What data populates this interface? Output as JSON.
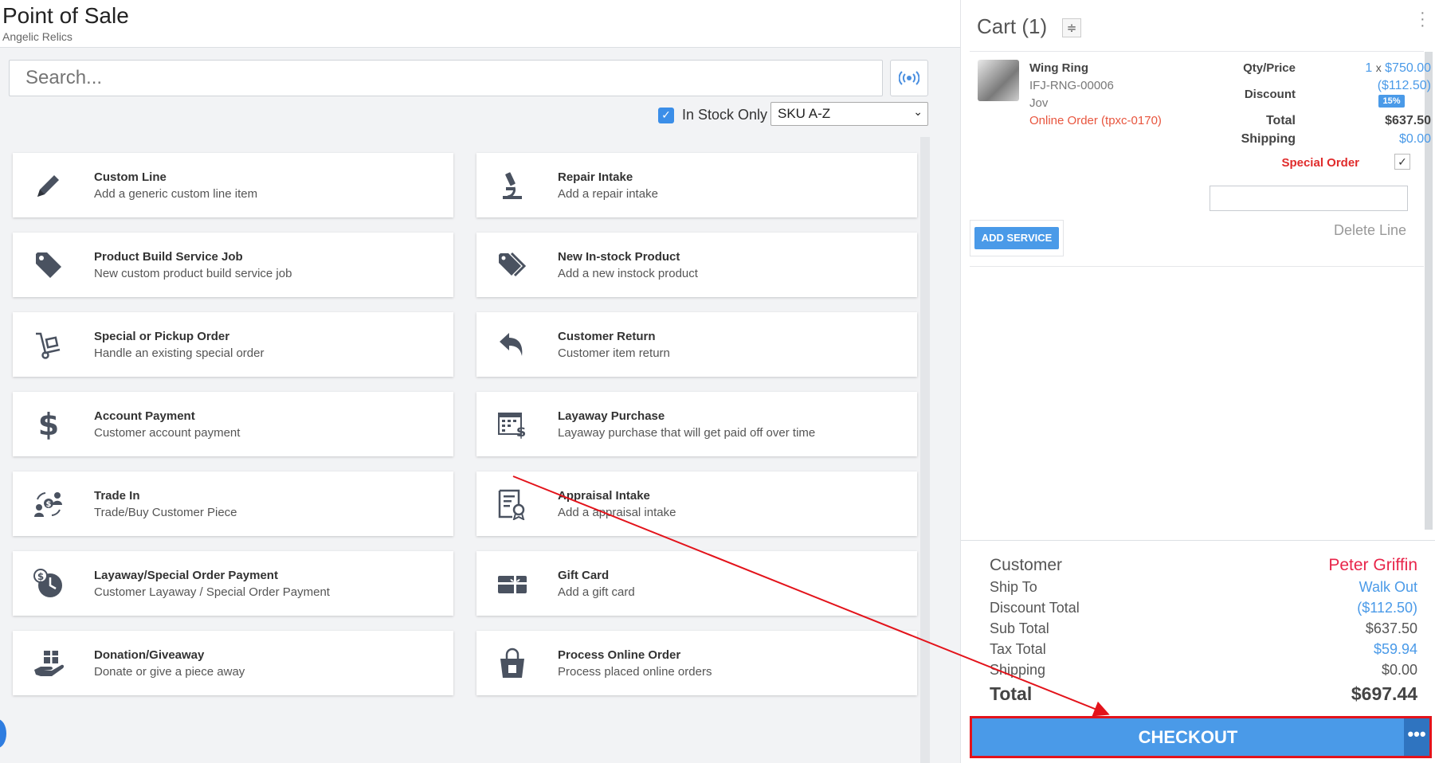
{
  "header": {
    "title": "Point of Sale",
    "subtitle": "Angelic Relics"
  },
  "search": {
    "placeholder": "Search..."
  },
  "filter": {
    "in_stock_label": "In Stock Only",
    "in_stock_checked": true,
    "sort_selected": "SKU A-Z"
  },
  "actions": [
    {
      "title": "Custom Line",
      "desc": "Add a generic custom line item",
      "icon": "pencil-icon"
    },
    {
      "title": "Repair Intake",
      "desc": "Add a repair intake",
      "icon": "microscope-icon"
    },
    {
      "title": "Product Build Service Job",
      "desc": "New custom product build service job",
      "icon": "tag-icon"
    },
    {
      "title": "New In-stock Product",
      "desc": "Add a new instock product",
      "icon": "tags-icon"
    },
    {
      "title": "Special or Pickup Order",
      "desc": "Handle an existing special order",
      "icon": "hand-truck-icon"
    },
    {
      "title": "Customer Return",
      "desc": "Customer item return",
      "icon": "undo-arrow-icon"
    },
    {
      "title": "Account Payment",
      "desc": "Customer account payment",
      "icon": "dollar-icon"
    },
    {
      "title": "Layaway Purchase",
      "desc": "Layaway purchase that will get paid off over time",
      "icon": "calendar-dollar-icon"
    },
    {
      "title": "Trade In",
      "desc": "Trade/Buy Customer Piece",
      "icon": "trade-people-icon"
    },
    {
      "title": "Appraisal Intake",
      "desc": "Add a appraisal intake",
      "icon": "certificate-icon"
    },
    {
      "title": "Layaway/Special Order Payment",
      "desc": "Customer Layaway / Special Order Payment",
      "icon": "clock-dollar-icon"
    },
    {
      "title": "Gift Card",
      "desc": "Add a gift card",
      "icon": "gift-card-icon"
    },
    {
      "title": "Donation/Giveaway",
      "desc": "Donate or give a piece away",
      "icon": "gift-hand-icon"
    },
    {
      "title": "Process Online Order",
      "desc": "Process placed online orders",
      "icon": "shopping-bag-icon"
    }
  ],
  "cart": {
    "title": "Cart (1)",
    "item": {
      "name": "Wing Ring",
      "sku": "IFJ-RNG-00006",
      "vendor": "Jov",
      "online_order": "Online Order (tpxc-0170)",
      "qty_price_label": "Qty/Price",
      "qty": "1",
      "qty_sep": "x",
      "price": "$750.00",
      "discount_label": "Discount",
      "discount": "($112.50)",
      "discount_pct": "15%",
      "total_label": "Total",
      "total": "$637.50",
      "shipping_label": "Shipping",
      "shipping": "$0.00",
      "special_order_label": "Special Order",
      "special_order_checked": true
    },
    "add_service_label": "ADD SERVICE",
    "delete_line_label": "Delete Line"
  },
  "summary": {
    "customer_label": "Customer",
    "customer": "Peter Griffin",
    "ship_to_label": "Ship To",
    "ship_to": "Walk Out",
    "discount_total_label": "Discount Total",
    "discount_total": "($112.50)",
    "sub_total_label": "Sub Total",
    "sub_total": "$637.50",
    "tax_total_label": "Tax Total",
    "tax_total": "$59.94",
    "shipping_label": "Shipping",
    "shipping": "$0.00",
    "total_label": "Total",
    "total": "$697.44"
  },
  "checkout_label": "CHECKOUT",
  "more_label": "•••",
  "colors": {
    "accent": "#4a9ae8",
    "alert": "#e02b2b",
    "online": "#e8553e",
    "customer": "#e8254a",
    "annotation": "#e3131b"
  }
}
